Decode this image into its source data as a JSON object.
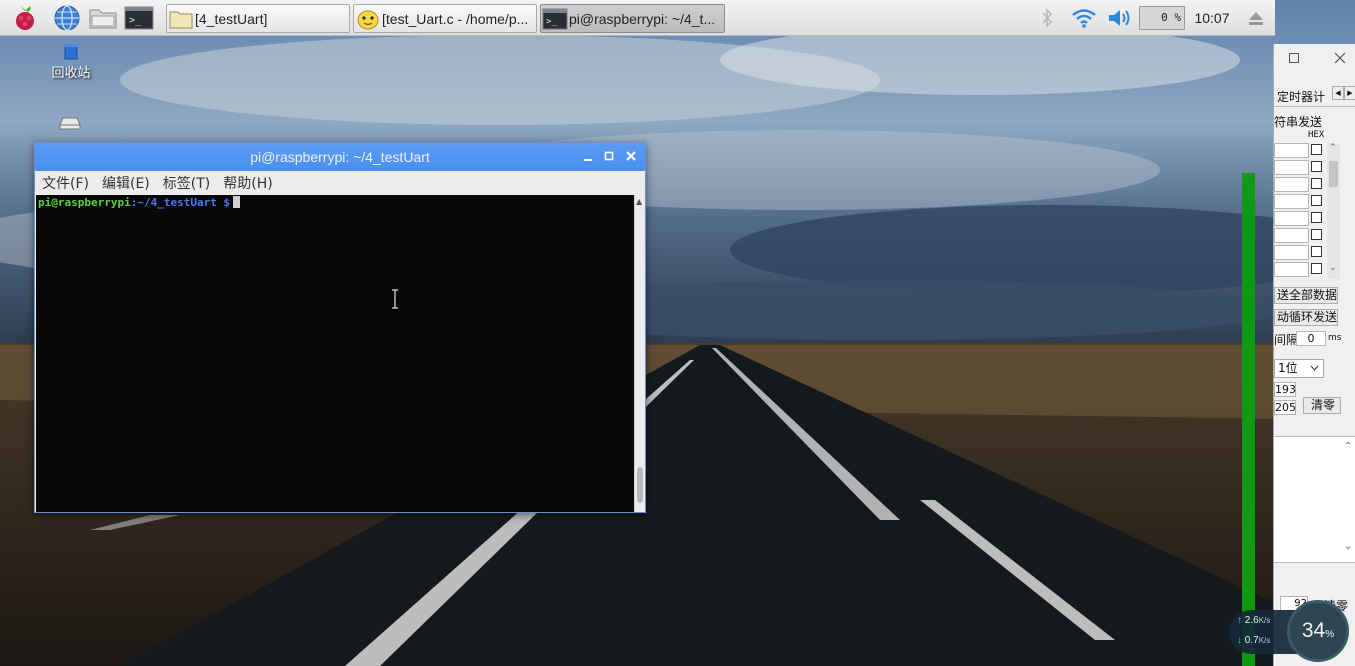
{
  "taskbar": {
    "tasks": [
      {
        "label": "[4_testUart]",
        "icon": "folder-icon"
      },
      {
        "label": "[test_Uart.c - /home/p...",
        "icon": "text-editor-icon"
      },
      {
        "label": "pi@raspberrypi: ~/4_t...",
        "icon": "terminal-icon"
      }
    ],
    "cpu_label": "0 %",
    "clock": "10:07"
  },
  "desktop": {
    "trash_label": "回收站"
  },
  "terminal": {
    "title": "pi@raspberrypi: ~/4_testUart",
    "menu": [
      "文件(F)",
      "编辑(E)",
      "标签(T)",
      "帮助(H)"
    ],
    "prompt_user": "pi@raspberrypi",
    "prompt_path": ":~/4_testUart",
    "prompt_sign": " $"
  },
  "serial_tool": {
    "tab_label": "定时器计",
    "section_label": "符串发送",
    "hex_header": "HEX",
    "send_all_label": "送全部数据",
    "auto_loop_label": "动循环发送",
    "interval_label": "间隔",
    "interval_value": "0",
    "interval_unit": "ms",
    "stop_bits": "1位",
    "count_1": "193",
    "count_2": "205",
    "clear_label": "清零",
    "bottom_value": "92",
    "bottom_clear_label": "清零"
  },
  "speed_widget": {
    "upload": "2.6",
    "download": "0.7",
    "unit": "K/s",
    "percent": "34",
    "percent_sign": "%"
  },
  "colors": {
    "titlebar": "#4b8ff0",
    "prompt_user": "#5ed33b",
    "prompt_path": "#4b76f0",
    "meter_green": "#0f9a13"
  }
}
